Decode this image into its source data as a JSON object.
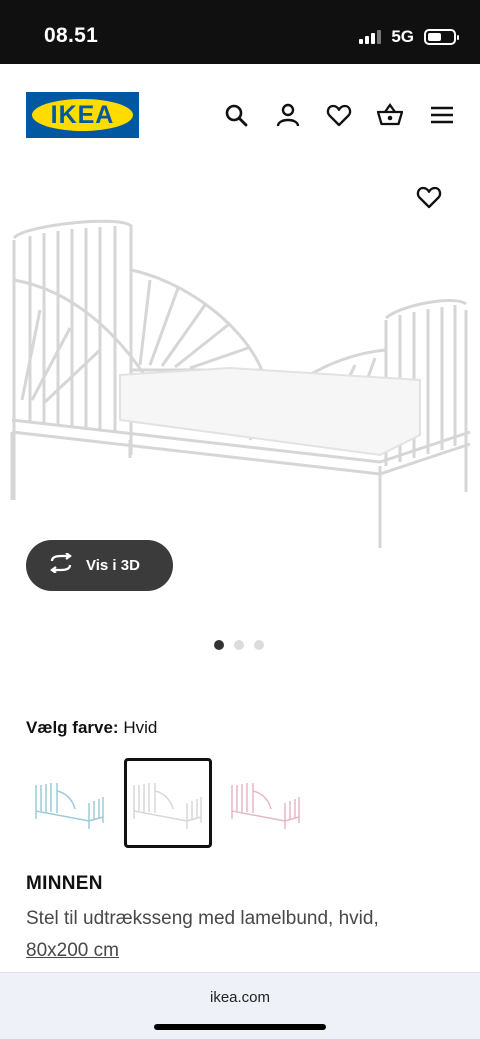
{
  "status": {
    "time": "08.51",
    "network": "5G",
    "battery_level": 0.55
  },
  "header": {
    "logo_text": "IKEA",
    "icons": [
      "search-icon",
      "user-icon",
      "heart-icon",
      "basket-icon",
      "menu-icon"
    ]
  },
  "gallery": {
    "button_3d_label": "Vis i 3D",
    "slide_count": 3,
    "active_slide": 1
  },
  "color": {
    "label": "Vælg farve:",
    "value": "Hvid",
    "options": [
      {
        "name": "blue",
        "hex": "#9ccad8",
        "selected": false
      },
      {
        "name": "white",
        "hex": "#e8e8e8",
        "selected": true
      },
      {
        "name": "pink",
        "hex": "#e9b7c6",
        "selected": false
      }
    ]
  },
  "product": {
    "name": "MINNEN",
    "description": "Stel til udtræksseng med lamelbund, hvid,",
    "size": "80x200 cm"
  },
  "browser": {
    "url": "ikea.com"
  },
  "colors": {
    "brand_blue": "#0058a3",
    "brand_yellow": "#ffdb00",
    "button_dark": "#3b3b3b"
  }
}
